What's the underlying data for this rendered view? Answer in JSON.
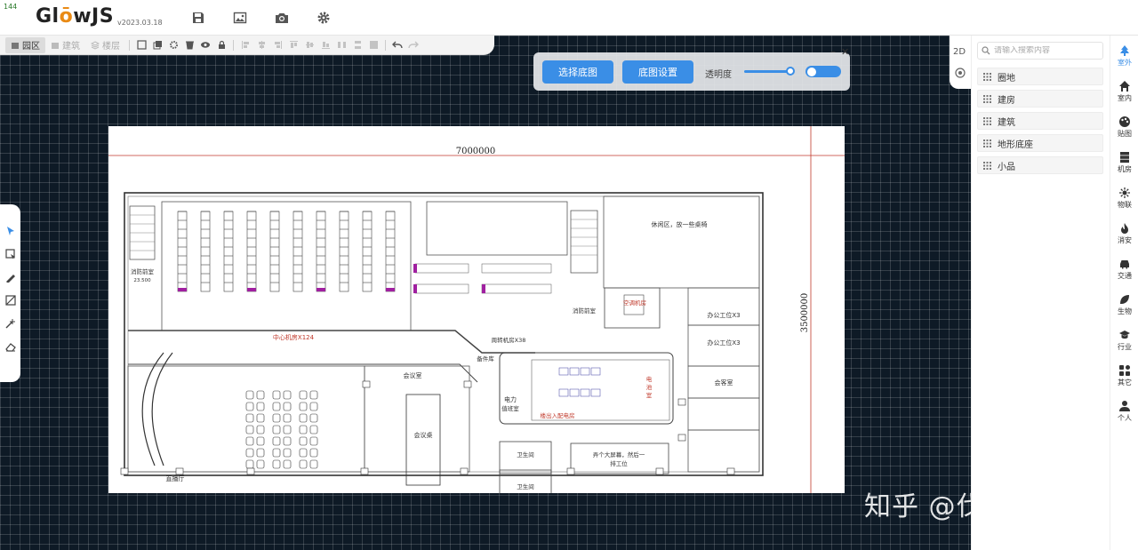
{
  "fps": "144",
  "app": {
    "logo_text_pre": "Gl",
    "logo_text_o": "ō",
    "logo_text_post": "wJS",
    "version": "v2023.03.18",
    "header_icons": [
      "save-icon",
      "image-icon",
      "camera-icon",
      "gear-icon"
    ]
  },
  "toolbar": {
    "tabs": [
      {
        "label": "园区",
        "active": true
      },
      {
        "label": "建筑",
        "active": false
      },
      {
        "label": "楼层",
        "active": false
      }
    ]
  },
  "map_panel": {
    "select_button": "选择底图",
    "settings_button": "底图设置",
    "opacity_label": "透明度",
    "opacity_level": 0.87,
    "visible": true
  },
  "view": {
    "mode_2d": "2D"
  },
  "sidebar": {
    "search_placeholder": "请输入搜索内容",
    "categories": [
      "圈地",
      "建房",
      "建筑",
      "地形底座",
      "小品"
    ]
  },
  "rail": [
    {
      "label": "室外",
      "icon": "tree-icon",
      "active": true
    },
    {
      "label": "室内",
      "icon": "home-icon",
      "active": false
    },
    {
      "label": "贴图",
      "icon": "palette-icon",
      "active": false
    },
    {
      "label": "机房",
      "icon": "server-icon",
      "active": false
    },
    {
      "label": "物联",
      "icon": "iot-icon",
      "active": false
    },
    {
      "label": "消安",
      "icon": "fire-icon",
      "active": false
    },
    {
      "label": "交通",
      "icon": "car-icon",
      "active": false
    },
    {
      "label": "生物",
      "icon": "leaf-icon",
      "active": false
    },
    {
      "label": "行业",
      "icon": "graduation-icon",
      "active": false
    },
    {
      "label": "其它",
      "icon": "grid-icon",
      "active": false
    },
    {
      "label": "个人",
      "icon": "user-icon",
      "active": false
    }
  ],
  "floor_plan": {
    "width_dim": "7000000",
    "height_dim": "3500000",
    "rooms": {
      "fire_left": "消防前室",
      "fire_left_num": "23.500",
      "machine_center": "中心机房X124",
      "turnover": "周转机房X38",
      "fire_right": "消防前室",
      "ac_room": "空调机房",
      "rest": "休闲区，放一些桌椅",
      "office1": "办公工位X3",
      "office2": "办公工位X3",
      "reception": "会客室",
      "meeting": "会议室",
      "meeting_table": "会议桌",
      "spare": "备件库",
      "power": "电力",
      "duty": "值班室",
      "battery1": "电",
      "battery2": "池",
      "battery3": "室",
      "dist": "楼出入配电房",
      "live": "直播厅",
      "wc1": "卫生间",
      "wc2": "卫生间",
      "screen1": "弄个大屏幕，然后一",
      "screen2": "排工位"
    }
  },
  "watermark": "知乎 @伐木工人"
}
